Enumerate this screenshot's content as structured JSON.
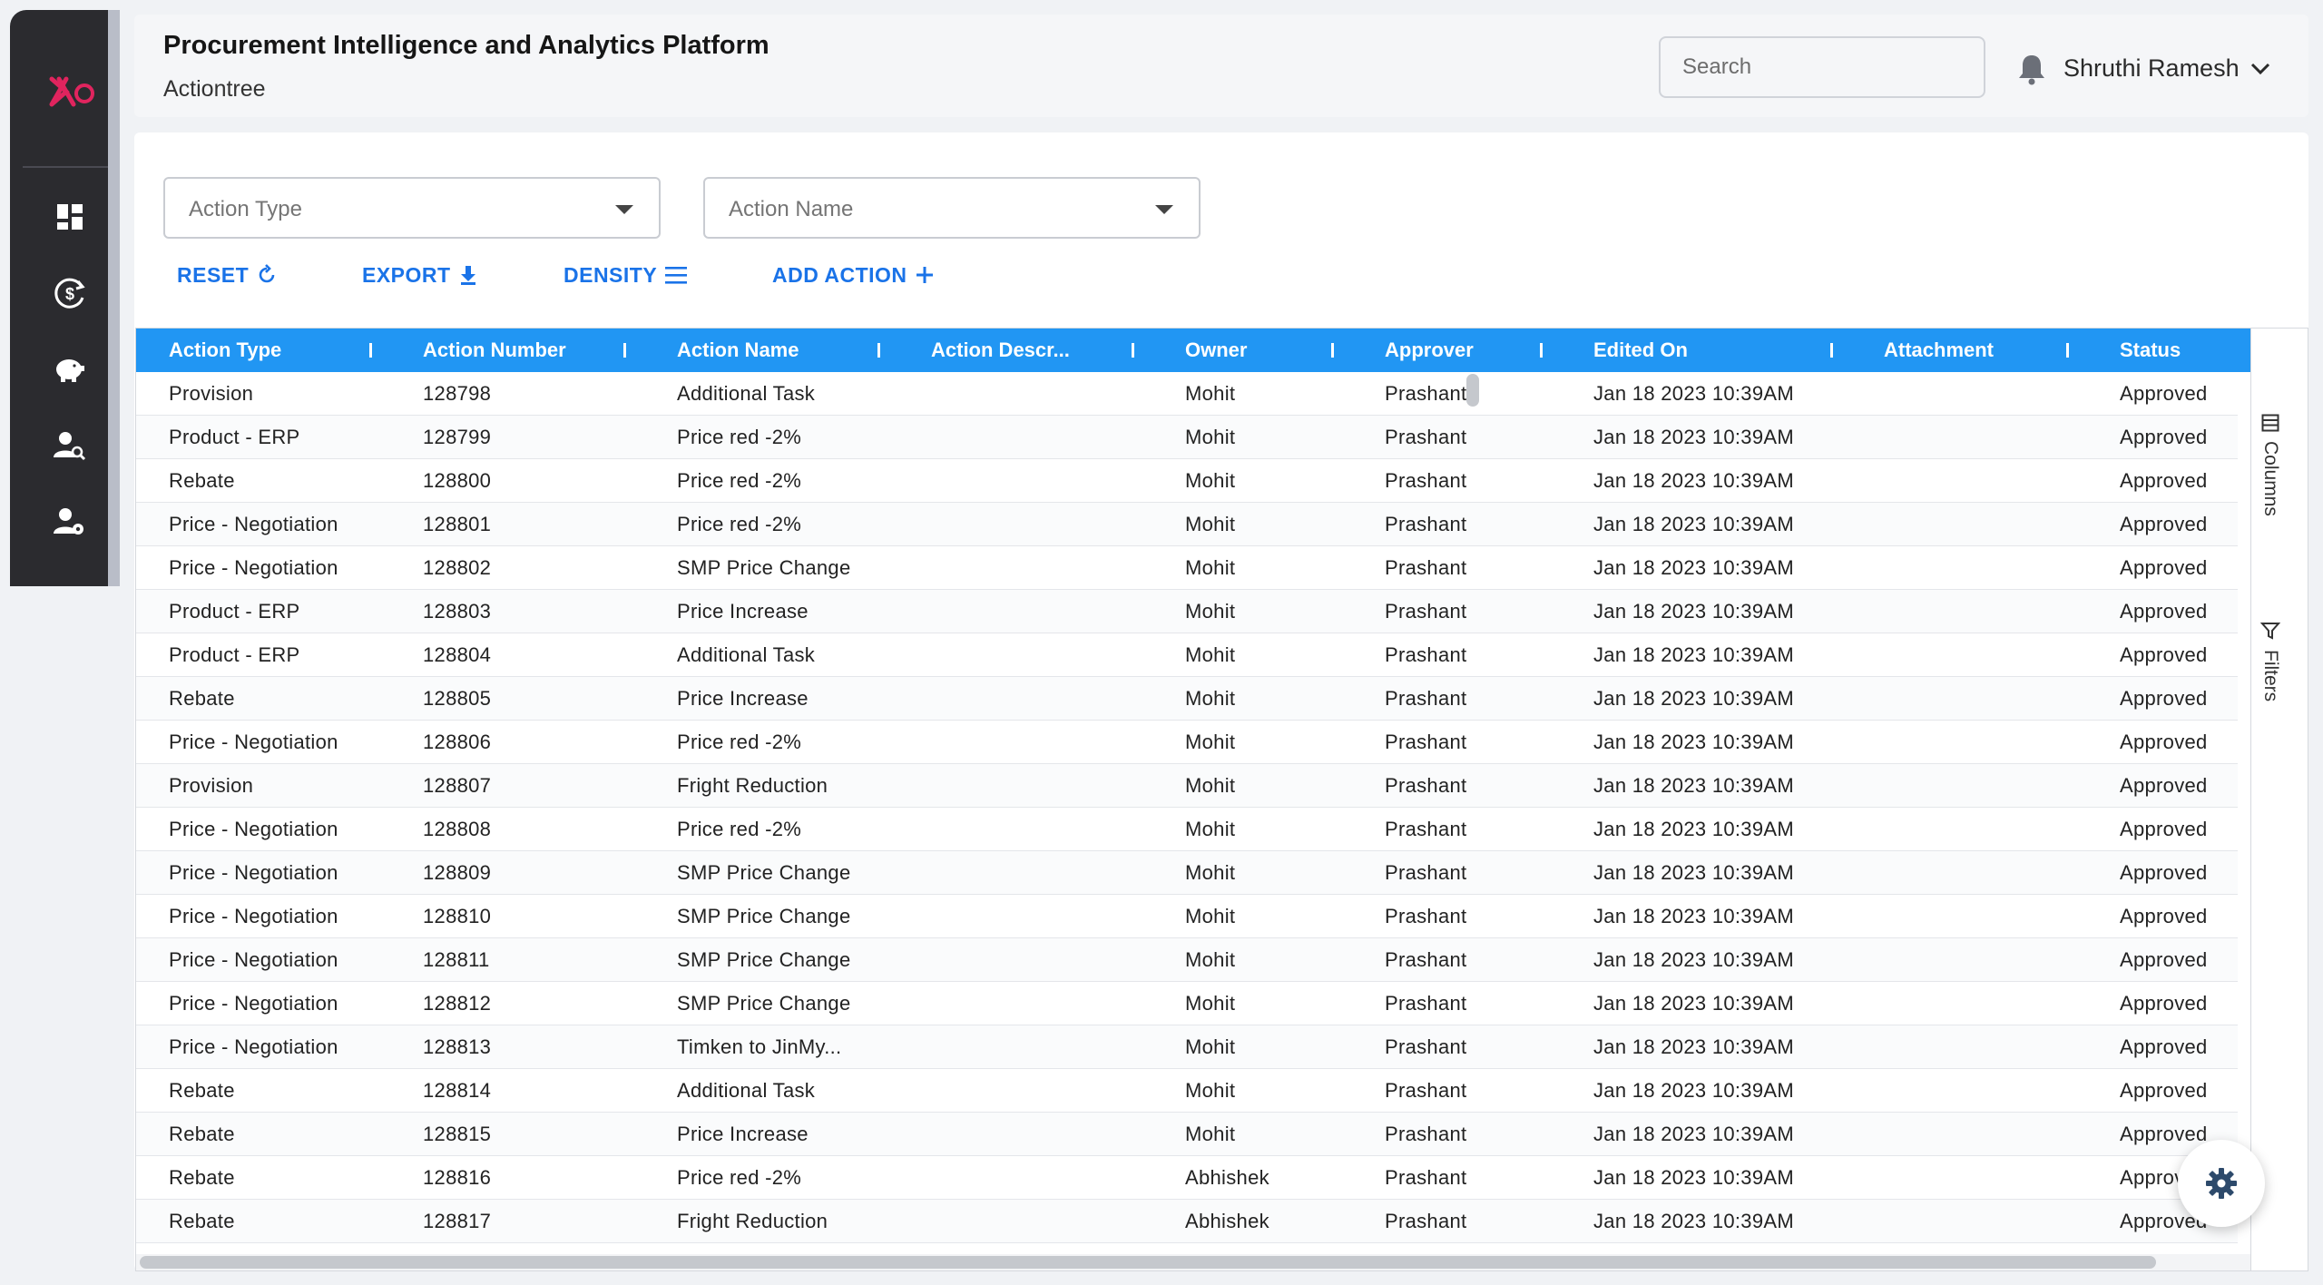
{
  "app": {
    "title": "Procurement Intelligence and Analytics Platform",
    "subtitle": "Actiontree"
  },
  "header": {
    "search_placeholder": "Search",
    "user_name": "Shruthi Ramesh"
  },
  "sidebar": {
    "items": [
      {
        "icon": "dashboard-icon"
      },
      {
        "icon": "dollar-cycle-icon"
      },
      {
        "icon": "piggy-bank-icon"
      },
      {
        "icon": "user-search-icon"
      },
      {
        "icon": "user-settings-icon"
      }
    ]
  },
  "filters": {
    "action_type_placeholder": "Action Type",
    "action_name_placeholder": "Action Name"
  },
  "toolbar": {
    "reset_label": "RESET",
    "export_label": "EXPORT",
    "density_label": "DENSITY",
    "add_action_label": "ADD ACTION"
  },
  "grid": {
    "columns": [
      "Action Type",
      "Action Number",
      "Action Name",
      "Action Descr...",
      "Owner",
      "Approver",
      "Edited On",
      "Attachment",
      "Status"
    ],
    "rows": [
      [
        "Provision",
        "128798",
        "Additional Task",
        "",
        "Mohit",
        "Prashant",
        "Jan 18 2023 10:39AM",
        "",
        "Approved"
      ],
      [
        "Product - ERP",
        "128799",
        "Price red -2%",
        "",
        "Mohit",
        "Prashant",
        "Jan 18 2023 10:39AM",
        "",
        "Approved"
      ],
      [
        "Rebate",
        "128800",
        "Price red -2%",
        "",
        "Mohit",
        "Prashant",
        "Jan 18 2023 10:39AM",
        "",
        "Approved"
      ],
      [
        "Price - Negotiation",
        "128801",
        "Price red -2%",
        "",
        "Mohit",
        "Prashant",
        "Jan 18 2023 10:39AM",
        "",
        "Approved"
      ],
      [
        "Price - Negotiation",
        "128802",
        "SMP Price Change",
        "",
        "Mohit",
        "Prashant",
        "Jan 18 2023 10:39AM",
        "",
        "Approved"
      ],
      [
        "Product - ERP",
        "128803",
        "Price Increase",
        "",
        "Mohit",
        "Prashant",
        "Jan 18 2023 10:39AM",
        "",
        "Approved"
      ],
      [
        "Product - ERP",
        "128804",
        "Additional Task",
        "",
        "Mohit",
        "Prashant",
        "Jan 18 2023 10:39AM",
        "",
        "Approved"
      ],
      [
        "Rebate",
        "128805",
        "Price Increase",
        "",
        "Mohit",
        "Prashant",
        "Jan 18 2023 10:39AM",
        "",
        "Approved"
      ],
      [
        "Price - Negotiation",
        "128806",
        "Price red -2%",
        "",
        "Mohit",
        "Prashant",
        "Jan 18 2023 10:39AM",
        "",
        "Approved"
      ],
      [
        "Provision",
        "128807",
        "Fright Reduction",
        "",
        "Mohit",
        "Prashant",
        "Jan 18 2023 10:39AM",
        "",
        "Approved"
      ],
      [
        "Price - Negotiation",
        "128808",
        "Price red -2%",
        "",
        "Mohit",
        "Prashant",
        "Jan 18 2023 10:39AM",
        "",
        "Approved"
      ],
      [
        "Price - Negotiation",
        "128809",
        "SMP Price Change",
        "",
        "Mohit",
        "Prashant",
        "Jan 18 2023 10:39AM",
        "",
        "Approved"
      ],
      [
        "Price - Negotiation",
        "128810",
        "SMP Price Change",
        "",
        "Mohit",
        "Prashant",
        "Jan 18 2023 10:39AM",
        "",
        "Approved"
      ],
      [
        "Price - Negotiation",
        "128811",
        "SMP Price Change",
        "",
        "Mohit",
        "Prashant",
        "Jan 18 2023 10:39AM",
        "",
        "Approved"
      ],
      [
        "Price - Negotiation",
        "128812",
        "SMP Price Change",
        "",
        "Mohit",
        "Prashant",
        "Jan 18 2023 10:39AM",
        "",
        "Approved"
      ],
      [
        "Price - Negotiation",
        "128813",
        "Timken to JinMy...",
        "",
        "Mohit",
        "Prashant",
        "Jan 18 2023 10:39AM",
        "",
        "Approved"
      ],
      [
        "Rebate",
        "128814",
        "Additional Task",
        "",
        "Mohit",
        "Prashant",
        "Jan 18 2023 10:39AM",
        "",
        "Approved"
      ],
      [
        "Rebate",
        "128815",
        "Price Increase",
        "",
        "Mohit",
        "Prashant",
        "Jan 18 2023 10:39AM",
        "",
        "Approved"
      ],
      [
        "Rebate",
        "128816",
        "Price red -2%",
        "",
        "Abhishek",
        "Prashant",
        "Jan 18 2023 10:39AM",
        "",
        "Approved"
      ],
      [
        "Rebate",
        "128817",
        "Fright Reduction",
        "",
        "Abhishek",
        "Prashant",
        "Jan 18 2023 10:39AM",
        "",
        "Approved"
      ]
    ]
  },
  "side_panel": {
    "columns_label": "Columns",
    "filters_label": "Filters"
  },
  "colors": {
    "accent": "#1a73e8",
    "grid_header": "#2196f3",
    "sidebar": "#2b2b2f",
    "logo": "#e0245e"
  }
}
